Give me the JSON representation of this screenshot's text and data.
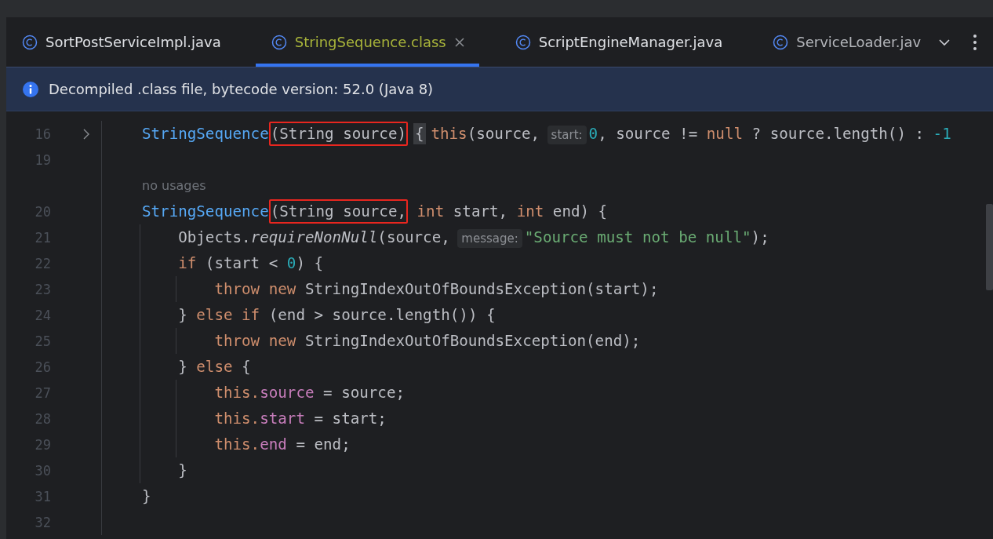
{
  "tabs": [
    {
      "label": "SortPostServiceImpl.java",
      "selected": false
    },
    {
      "label": "StringSequence.class",
      "selected": true,
      "closable": true
    },
    {
      "label": "ScriptEngineManager.java",
      "selected": false
    },
    {
      "label": "ServiceLoader.jav",
      "selected": false,
      "faded": true
    }
  ],
  "banner": {
    "text": "Decompiled .class file, bytecode version: 52.0 (Java 8)"
  },
  "lines": [
    {
      "number": "16",
      "fold": true,
      "tokens": [
        {
          "kind": "fn",
          "text": "StringSequence"
        },
        {
          "kind": "boxed",
          "text": "(String source)"
        },
        {
          "kind": "brace",
          "text": "{"
        },
        {
          "kind": "kw",
          "text": "this"
        },
        {
          "kind": "plain",
          "text": "(source,"
        },
        {
          "kind": "hint",
          "text": "start:"
        },
        {
          "kind": "num",
          "text": "0"
        },
        {
          "kind": "plain",
          "text": ", source != "
        },
        {
          "kind": "kw",
          "text": "null"
        },
        {
          "kind": "plain",
          "text": " ? source.length() : "
        },
        {
          "kind": "num",
          "text": "-1"
        }
      ]
    },
    {
      "number": "19"
    },
    {
      "kind": "usage",
      "text": "no usages"
    },
    {
      "number": "20",
      "tokens": [
        {
          "kind": "fn",
          "text": "StringSequence"
        },
        {
          "kind": "boxed",
          "text": "(String source,"
        },
        {
          "kind": "kw",
          "text": " int"
        },
        {
          "kind": "plain",
          "text": " start, "
        },
        {
          "kind": "kw",
          "text": "int"
        },
        {
          "kind": "plain",
          "text": " end) {"
        }
      ],
      "children": [
        {
          "number": "21",
          "tokens": [
            {
              "kind": "plain",
              "text": "Objects."
            },
            {
              "kind": "italic",
              "text": "requireNonNull"
            },
            {
              "kind": "plain",
              "text": "(source,"
            },
            {
              "kind": "hint",
              "text": "message:"
            },
            {
              "kind": "str",
              "text": "\"Source must not be null\""
            },
            {
              "kind": "plain",
              "text": ");"
            }
          ]
        },
        {
          "number": "22",
          "tokens": [
            {
              "kind": "kw",
              "text": "if"
            },
            {
              "kind": "plain",
              "text": " (start < "
            },
            {
              "kind": "num",
              "text": "0"
            },
            {
              "kind": "plain",
              "text": ") {"
            }
          ],
          "children": [
            {
              "number": "23",
              "tokens": [
                {
                  "kind": "kw",
                  "text": "throw new"
                },
                {
                  "kind": "plain",
                  "text": " StringIndexOutOfBoundsException(start);"
                }
              ]
            }
          ]
        },
        {
          "number": "24",
          "tokens": [
            {
              "kind": "plain",
              "text": "} "
            },
            {
              "kind": "kw",
              "text": "else if"
            },
            {
              "kind": "plain",
              "text": " (end > source.length()) {"
            }
          ],
          "children": [
            {
              "number": "25",
              "tokens": [
                {
                  "kind": "kw",
                  "text": "throw new"
                },
                {
                  "kind": "plain",
                  "text": " StringIndexOutOfBoundsException(end);"
                }
              ]
            }
          ]
        },
        {
          "number": "26",
          "tokens": [
            {
              "kind": "plain",
              "text": "} "
            },
            {
              "kind": "kw",
              "text": "else"
            },
            {
              "kind": "plain",
              "text": " {"
            }
          ],
          "children": [
            {
              "number": "27",
              "tokens": [
                {
                  "kind": "kw",
                  "text": "this."
                },
                {
                  "kind": "field",
                  "text": "source"
                },
                {
                  "kind": "plain",
                  "text": " = source;"
                }
              ]
            },
            {
              "number": "28",
              "tokens": [
                {
                  "kind": "kw",
                  "text": "this."
                },
                {
                  "kind": "field",
                  "text": "start"
                },
                {
                  "kind": "plain",
                  "text": " = start;"
                }
              ]
            },
            {
              "number": "29",
              "tokens": [
                {
                  "kind": "kw",
                  "text": "this."
                },
                {
                  "kind": "field",
                  "text": "end"
                },
                {
                  "kind": "plain",
                  "text": " = end;"
                }
              ]
            }
          ]
        },
        {
          "number": "30",
          "tokens": [
            {
              "kind": "plain",
              "text": "}"
            }
          ]
        }
      ]
    },
    {
      "number": "31",
      "tokens": [
        {
          "kind": "plain",
          "text": "}"
        }
      ]
    },
    {
      "number": "32"
    }
  ]
}
